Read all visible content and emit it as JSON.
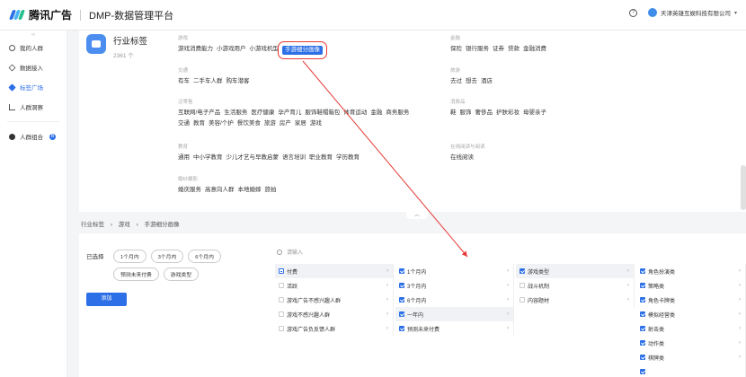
{
  "header": {
    "brand": "腾讯广告",
    "app_title": "DMP-数据管理平台",
    "help_icon": "question-icon",
    "company": "天津英雄互娱科技有限公司"
  },
  "colors": {
    "primary": "#2c6fe6",
    "highlight_box": "#e53935",
    "arrow": "#e53935"
  },
  "sidebar": {
    "collapse": "‹‹",
    "items": [
      {
        "label": "我的人群",
        "icon": "user-circle-icon"
      },
      {
        "label": "数据接入",
        "icon": "layers-icon"
      },
      {
        "label": "标签广场",
        "icon": "tag-icon",
        "active": true
      },
      {
        "label": "人群洞察",
        "icon": "chart-icon"
      },
      {
        "label": "人群组合",
        "icon": "combine-icon",
        "badge": "B"
      }
    ]
  },
  "industry": {
    "title": "行业标签",
    "count": "2361 个"
  },
  "groups": [
    {
      "title": "游戏",
      "items": [
        "游戏消费能力",
        "小游戏用户",
        "小游戏机型",
        "手游细分画像"
      ],
      "selected": "手游细分画像"
    },
    {
      "title": "金融",
      "items": [
        "保险",
        "银行服务",
        "证券",
        "贷款",
        "金融消费"
      ]
    },
    {
      "title": "交通",
      "items": [
        "有车",
        "二手车人群",
        "购车潜客"
      ]
    },
    {
      "title": "旅游",
      "items": [
        "去过",
        "想去",
        "酒店"
      ]
    },
    {
      "title": "泛零售",
      "items": [
        "互联网/电子产品",
        "生活服务",
        "医疗健康",
        "孕产育儿",
        "服饰鞋帽箱包",
        "体育运动",
        "金融",
        "商务服务",
        "交通",
        "教育",
        "美容/个护",
        "餐饮美食",
        "旅游",
        "房产",
        "家居",
        "游戏"
      ]
    },
    {
      "title": "消费品",
      "items": [
        "鞋",
        "服饰",
        "奢侈品",
        "护肤彩妆",
        "母婴亲子"
      ]
    },
    {
      "title": "教育",
      "items": [
        "通用",
        "中小学教育",
        "少儿才艺与早教启蒙",
        "语言培训",
        "职业教育",
        "学历教育"
      ]
    },
    {
      "title": "在线阅读与阅读",
      "items": [
        "在线阅读"
      ]
    },
    {
      "title": "婚纱摄影",
      "items": [
        "婚庆服务",
        "高意向人群",
        "本地婚嫁",
        "旅拍"
      ]
    }
  ],
  "breadcrumb": [
    "行业标签",
    "›",
    "游戏",
    "›",
    "手游细分画像"
  ],
  "selection": {
    "chosen_label": "已选择",
    "chips": [
      "1个月内",
      "3个月内",
      "6个月内",
      "预测未来付费",
      "游戏类型"
    ],
    "add_button": "添加",
    "search_placeholder": "请输入"
  },
  "columns": [
    {
      "rows": [
        {
          "label": "付费",
          "state": "part",
          "hl": true,
          "arrow": true
        },
        {
          "label": "活跃",
          "state": "off",
          "arrow": true
        },
        {
          "label": "游戏广告不感兴趣人群",
          "state": "off",
          "arrow": true
        },
        {
          "label": "游戏不感兴趣人群",
          "state": "off",
          "arrow": true
        },
        {
          "label": "游戏广告负反馈人群",
          "state": "off",
          "arrow": true
        }
      ]
    },
    {
      "rows": [
        {
          "label": "1个月内",
          "state": "on",
          "arrow": true
        },
        {
          "label": "3个月内",
          "state": "on",
          "arrow": true
        },
        {
          "label": "6个月内",
          "state": "on",
          "arrow": true
        },
        {
          "label": "一年内",
          "state": "on",
          "hl": true,
          "arrow": true
        },
        {
          "label": "预测未来付费",
          "state": "on",
          "arrow": true
        }
      ]
    },
    {
      "rows": [
        {
          "label": "游戏类型",
          "state": "on",
          "hl": true,
          "arrow": true
        },
        {
          "label": "战斗机制",
          "state": "off",
          "arrow": true
        },
        {
          "label": "内容题材",
          "state": "off",
          "arrow": true
        }
      ]
    },
    {
      "rows": [
        {
          "label": "角色扮演类",
          "state": "on",
          "arrow": true
        },
        {
          "label": "策略类",
          "state": "on",
          "arrow": true
        },
        {
          "label": "角色卡牌类",
          "state": "on",
          "arrow": true
        },
        {
          "label": "模拟经营类",
          "state": "on",
          "arrow": true
        },
        {
          "label": "射击类",
          "state": "on",
          "arrow": true
        },
        {
          "label": "动作类",
          "state": "on",
          "arrow": true
        },
        {
          "label": "棋牌类",
          "state": "on",
          "arrow": true
        },
        {
          "label": "",
          "state": "on",
          "arrow": false
        }
      ]
    }
  ]
}
